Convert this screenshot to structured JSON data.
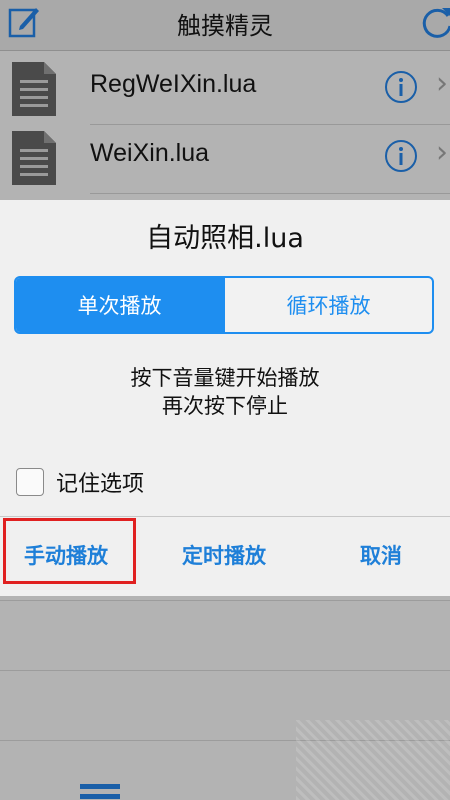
{
  "app": {
    "title": "触摸精灵",
    "files": [
      {
        "name": "RegWeIXin.lua"
      },
      {
        "name": "WeiXin.lua"
      }
    ]
  },
  "dialog": {
    "title": "自动照相.lua",
    "segments": [
      "单次播放",
      "循环播放"
    ],
    "selected_segment": "单次播放",
    "hint_line1": "按下音量键开始播放",
    "hint_line2": "再次按下停止",
    "remember_label": "记住选项",
    "remember_checked": false,
    "actions": {
      "manual": "手动播放",
      "timed": "定时播放",
      "cancel": "取消"
    }
  },
  "colors": {
    "accent": "#1e8ef0",
    "highlight": "#e02020"
  },
  "icons": [
    "edit-icon",
    "refresh-icon",
    "document-icon",
    "info-icon",
    "chevron-right-icon",
    "menu-icon"
  ]
}
